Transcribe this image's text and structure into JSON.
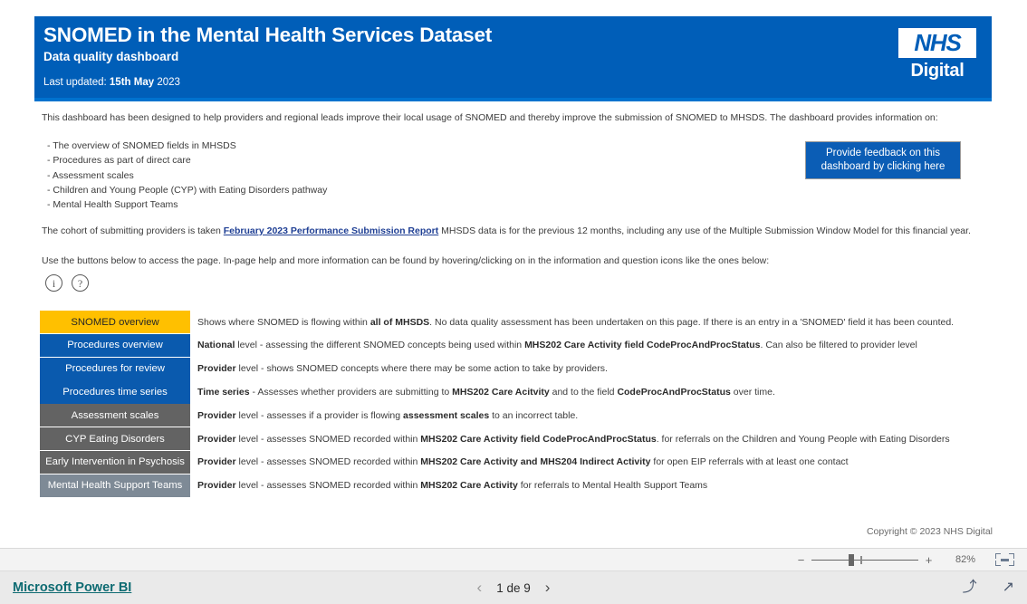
{
  "header": {
    "title": "SNOMED in the Mental Health Services Dataset",
    "subtitle": "Data quality dashboard",
    "updated_label": "Last updated: ",
    "updated_date_bold": "15th May",
    "updated_date_plain": " 2023",
    "logo_nhs": "NHS",
    "logo_digital": "Digital"
  },
  "intro": {
    "paragraph": "This dashboard has been designed to help providers and regional leads improve their local usage of SNOMED and thereby improve the submission of SNOMED to MHSDS. The dashboard provides information on:",
    "bullets": [
      "- The overview of SNOMED fields in MHSDS",
      "- Procedures as part of direct care",
      "- Assessment scales",
      "- Children and Young People (CYP) with Eating Disorders pathway",
      "- Mental Health Support Teams"
    ],
    "cohort_prefix": "The cohort of submitting providers is taken ",
    "cohort_link": "February 2023 Performance Submission Report",
    "cohort_suffix": "  MHSDS data is for the previous 12 months, including any use of the Multiple Submission Window Model for this financial year.",
    "usage_paragraph": "Use the buttons below to access the page. In-page help and more information can be found by hovering/clicking on in the information and question icons like the ones below:",
    "info_icon_glyph": "i",
    "question_icon_glyph": "?"
  },
  "feedback_button": {
    "line1": "Provide feedback on this",
    "line2": "dashboard by clicking here"
  },
  "nav_table": {
    "rows": [
      {
        "label": "SNOMED overview",
        "style": "amber",
        "desc_parts": [
          {
            "text": "Shows where SNOMED is flowing within ",
            "bold": false
          },
          {
            "text": "all of MHSDS",
            "bold": true
          },
          {
            "text": ". No data quality assessment has been undertaken on this page. If there is an entry in a 'SNOMED' field it has been counted.",
            "bold": false
          }
        ]
      },
      {
        "label": "Procedures overview",
        "style": "blue",
        "desc_parts": [
          {
            "text": "National",
            "bold": true
          },
          {
            "text": " level - assessing the different SNOMED concepts being used within ",
            "bold": false
          },
          {
            "text": "MHS202 Care Activity field CodeProcAndProcStatus",
            "bold": true
          },
          {
            "text": ". Can also be filtered to provider level",
            "bold": false
          }
        ]
      },
      {
        "label": "Procedures for review",
        "style": "blue",
        "desc_parts": [
          {
            "text": "Provider",
            "bold": true
          },
          {
            "text": " level - shows SNOMED concepts where there may be some action to take by providers.",
            "bold": false
          }
        ]
      },
      {
        "label": "Procedures time series",
        "style": "blue",
        "desc_parts": [
          {
            "text": "Time series",
            "bold": true
          },
          {
            "text": " - Assesses whether providers are submitting to ",
            "bold": false
          },
          {
            "text": "MHS202 Care Acitvity",
            "bold": true
          },
          {
            "text": " and to the field ",
            "bold": false
          },
          {
            "text": "CodeProcAndProcStatus",
            "bold": true
          },
          {
            "text": " over time.",
            "bold": false
          }
        ]
      },
      {
        "label": "Assessment scales",
        "style": "grey",
        "desc_parts": [
          {
            "text": "Provider",
            "bold": true
          },
          {
            "text": " level - assesses if a provider is flowing ",
            "bold": false
          },
          {
            "text": "assessment scales",
            "bold": true
          },
          {
            "text": " to an incorrect table.",
            "bold": false
          }
        ]
      },
      {
        "label": "CYP Eating Disorders",
        "style": "grey",
        "desc_parts": [
          {
            "text": "Provider",
            "bold": true
          },
          {
            "text": " level - assesses SNOMED recorded within ",
            "bold": false
          },
          {
            "text": "MHS202 Care Activity field CodeProcAndProcStatus",
            "bold": true
          },
          {
            "text": ". for referrals on the Children and Young People with Eating Disorders",
            "bold": false
          }
        ]
      },
      {
        "label": "Early Intervention in Psychosis",
        "style": "grey",
        "desc_parts": [
          {
            "text": "Provider",
            "bold": true
          },
          {
            "text": " level - assesses SNOMED recorded within ",
            "bold": false
          },
          {
            "text": "MHS202 Care Activity and MHS204 Indirect Activity",
            "bold": true
          },
          {
            "text": " for open EIP referrals with at least one contact",
            "bold": false
          }
        ]
      },
      {
        "label": "Mental Health Support Teams",
        "style": "grey-light",
        "desc_parts": [
          {
            "text": " Provider",
            "bold": true
          },
          {
            "text": " level - assesses SNOMED recorded within ",
            "bold": false
          },
          {
            "text": "MHS202 Care Activity",
            "bold": true
          },
          {
            "text": " for referrals to Mental Health Support Teams",
            "bold": false
          }
        ]
      }
    ]
  },
  "copyright": "Copyright © 2023 NHS Digital",
  "zoom_bar": {
    "minus": "−",
    "plus": "+",
    "level": "82%",
    "fit_icon": "fit-to-page-icon"
  },
  "footer": {
    "powerbi_label": "Microsoft Power BI",
    "prev_glyph": "‹",
    "next_glyph": "›",
    "page_indicator": "1 de 9",
    "share_icon": "⤴",
    "fullscreen_icon": "↗"
  },
  "colors": {
    "nhs_blue": "#005EB8",
    "amber": "#FFC000",
    "button_blue": "#0A5AAE",
    "grey": "#636363",
    "grey_light": "#7e8a96",
    "link_teal": "#0e6b72"
  }
}
